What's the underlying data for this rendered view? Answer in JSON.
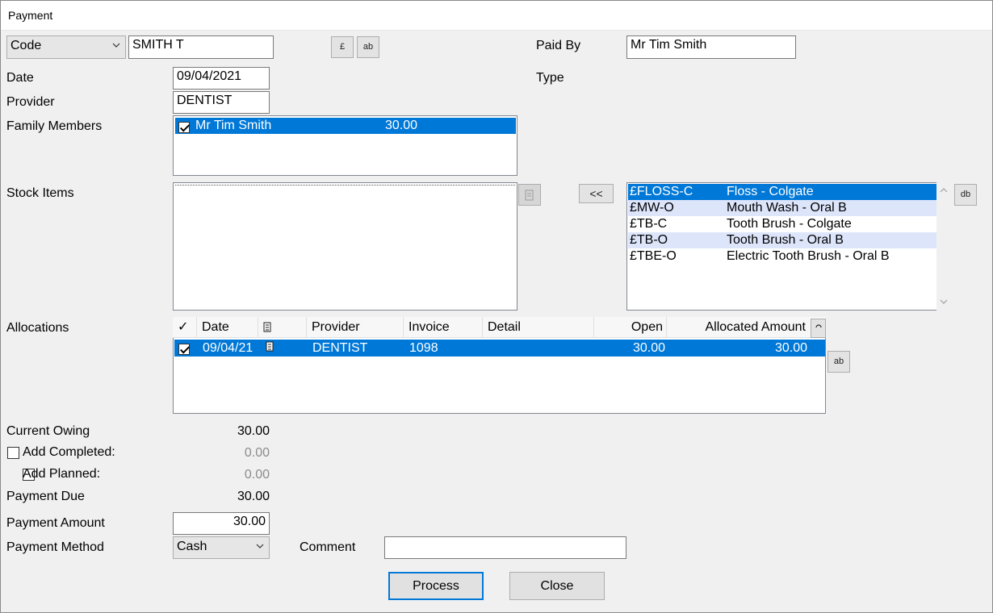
{
  "window": {
    "title": "Payment"
  },
  "code_select": {
    "value": "Code"
  },
  "code_input": {
    "value": "SMITH T"
  },
  "toolbar": {
    "pound_icon_text": "£",
    "edit_icon_text": "ab",
    "db_icon_text": "db"
  },
  "paid_by": {
    "label": "Paid By",
    "value": "Mr Tim Smith"
  },
  "type": {
    "label": "Type"
  },
  "date": {
    "label": "Date",
    "value": "09/04/2021"
  },
  "provider": {
    "label": "Provider",
    "value": "DENTIST"
  },
  "family": {
    "label": "Family Members",
    "items": [
      {
        "name": "Mr Tim Smith",
        "amount": "30.00",
        "checked": true
      }
    ]
  },
  "stock": {
    "label": "Stock Items",
    "move_button": "<<",
    "available": [
      {
        "code": "£FLOSS-C",
        "desc": "Floss - Colgate"
      },
      {
        "code": "£MW-O",
        "desc": "Mouth Wash - Oral B"
      },
      {
        "code": "£TB-C",
        "desc": "Tooth Brush - Colgate"
      },
      {
        "code": "£TB-O",
        "desc": "Tooth Brush - Oral B"
      },
      {
        "code": "£TBE-O",
        "desc": "Electric Tooth Brush - Oral B"
      }
    ]
  },
  "allocations": {
    "label": "Allocations",
    "columns": {
      "check": "✓",
      "date": "Date",
      "provider": "Provider",
      "invoice": "Invoice",
      "detail": "Detail",
      "open": "Open",
      "allocated": "Allocated Amount"
    },
    "rows": [
      {
        "date": "09/04/21",
        "provider": "DENTIST",
        "invoice": "1098",
        "detail": "",
        "open": "30.00",
        "allocated": "30.00",
        "checked": true
      }
    ]
  },
  "summary": {
    "current_owing": {
      "label": "Current Owing",
      "value": "30.00"
    },
    "add_completed": {
      "label": "Add Completed:",
      "value": "0.00"
    },
    "add_planned": {
      "label": "Add Planned:",
      "value": "0.00"
    },
    "payment_due": {
      "label": "Payment Due",
      "value": "30.00"
    }
  },
  "payment_amount": {
    "label": "Payment Amount",
    "value": "30.00"
  },
  "payment_method": {
    "label": "Payment Method",
    "value": "Cash"
  },
  "comment": {
    "label": "Comment",
    "value": ""
  },
  "buttons": {
    "process": "Process",
    "close": "Close"
  },
  "colors": {
    "selection": "#0078d7",
    "alt_row": "#dde5fb",
    "background": "#f0f0f0"
  }
}
